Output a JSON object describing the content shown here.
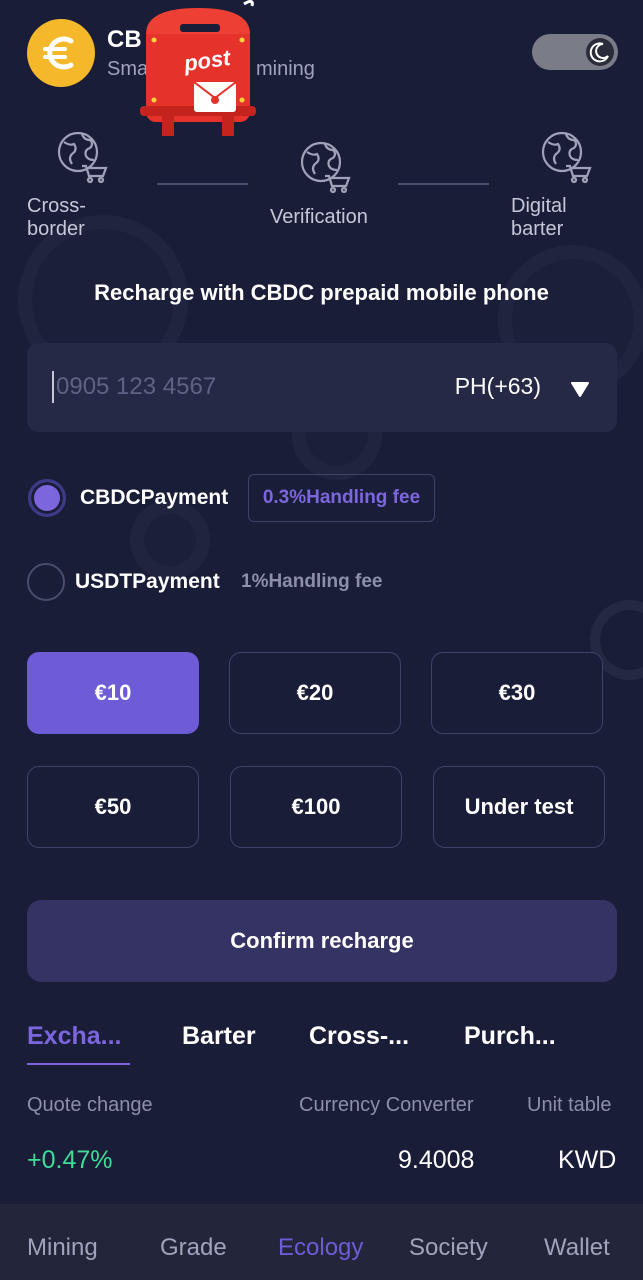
{
  "header": {
    "title": "CB",
    "subtitle": "Sma",
    "subtitle_tail": "mining",
    "logo_symbol": "€",
    "theme_toggle_icon": "moon-icon",
    "post_label": "post"
  },
  "steps": [
    {
      "label_line1": "Cross-",
      "label_line2": "border",
      "icon": "globe-cart-icon"
    },
    {
      "label_line1": "Verification",
      "label_line2": "",
      "icon": "globe-cart-icon"
    },
    {
      "label_line1": "Digital",
      "label_line2": "barter",
      "icon": "globe-cart-icon"
    }
  ],
  "section_title": "Recharge with CBDC prepaid mobile phone",
  "phone": {
    "placeholder": "0905 123 4567",
    "country": "PH(+63)"
  },
  "payments": [
    {
      "label": "CBDCPayment",
      "fee": "0.3%Handling fee",
      "selected": true
    },
    {
      "label": "USDTPayment",
      "fee": "1%Handling fee",
      "selected": false
    }
  ],
  "amounts": [
    {
      "label": "€10",
      "selected": true
    },
    {
      "label": "€20",
      "selected": false
    },
    {
      "label": "€30",
      "selected": false
    },
    {
      "label": "€50",
      "selected": false
    },
    {
      "label": "€100",
      "selected": false
    },
    {
      "label": "Under test",
      "selected": false
    }
  ],
  "confirm_label": "Confirm recharge",
  "tabs": [
    {
      "label": "Excha...",
      "active": true
    },
    {
      "label": "Barter",
      "active": false
    },
    {
      "label": "Cross-...",
      "active": false
    },
    {
      "label": "Purch...",
      "active": false
    }
  ],
  "table": {
    "headers": [
      "Quote change",
      "Currency Converter",
      "Unit table"
    ],
    "row": {
      "change": "+0.47%",
      "rate": "9.4008",
      "unit": "KWD"
    }
  },
  "nav": [
    {
      "label": "Mining",
      "active": false
    },
    {
      "label": "Grade",
      "active": false
    },
    {
      "label": "Ecology",
      "active": true
    },
    {
      "label": "Society",
      "active": false
    },
    {
      "label": "Wallet",
      "active": false
    }
  ],
  "colors": {
    "background": "#1a1d38",
    "accent": "#6e5bd6",
    "positive": "#3ddc97",
    "logo": "#f5b82a"
  }
}
